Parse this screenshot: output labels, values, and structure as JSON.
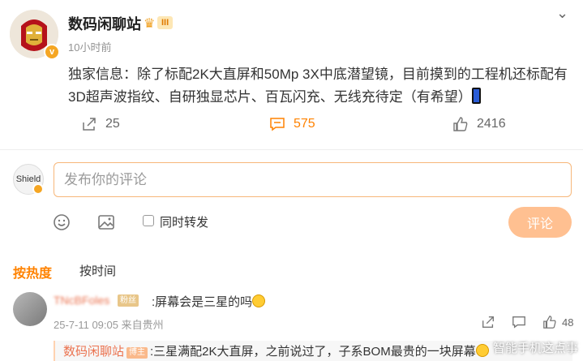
{
  "post": {
    "author": "数码闲聊站",
    "level_badge": "III",
    "verified_badge": "v",
    "time": "10小时前",
    "content": "独家信息：除了标配2K大直屏和50Mp 3X中底潜望镜，目前摸到的工程机还标配有3D超声波指纹、自研独显芯片、百瓦闪充、无线充待定（有希望）",
    "content_emoji": "phone-emoji",
    "share_count": "25",
    "comment_count": "575",
    "like_count": "2416",
    "more_icon": "chevron-down-icon"
  },
  "compose": {
    "placeholder": "发布你的评论",
    "repost_label": "同时转发",
    "submit_label": "评论",
    "my_avatar_text": "Shield"
  },
  "sort": {
    "hot_label": "按热度",
    "time_label": "按时间"
  },
  "comments": [
    {
      "user": "TNcBFoles",
      "badge": "粉丝",
      "text": ":屏幕会是三星的吗",
      "meta": "25-7-11 09:05 来自贵州",
      "likes": "48",
      "reply": {
        "user": "数码闲聊站",
        "badge": "博主",
        "text": ":三星满配2K大直屏，之前说过了，子系BOM最贵的一块屏幕"
      }
    }
  ],
  "watermark": "智能手机这点事",
  "colors": {
    "accent": "#ff8200",
    "username_link": "#eb7350",
    "submit_disabled": "#ffc091",
    "input_border": "#f7b77a"
  }
}
